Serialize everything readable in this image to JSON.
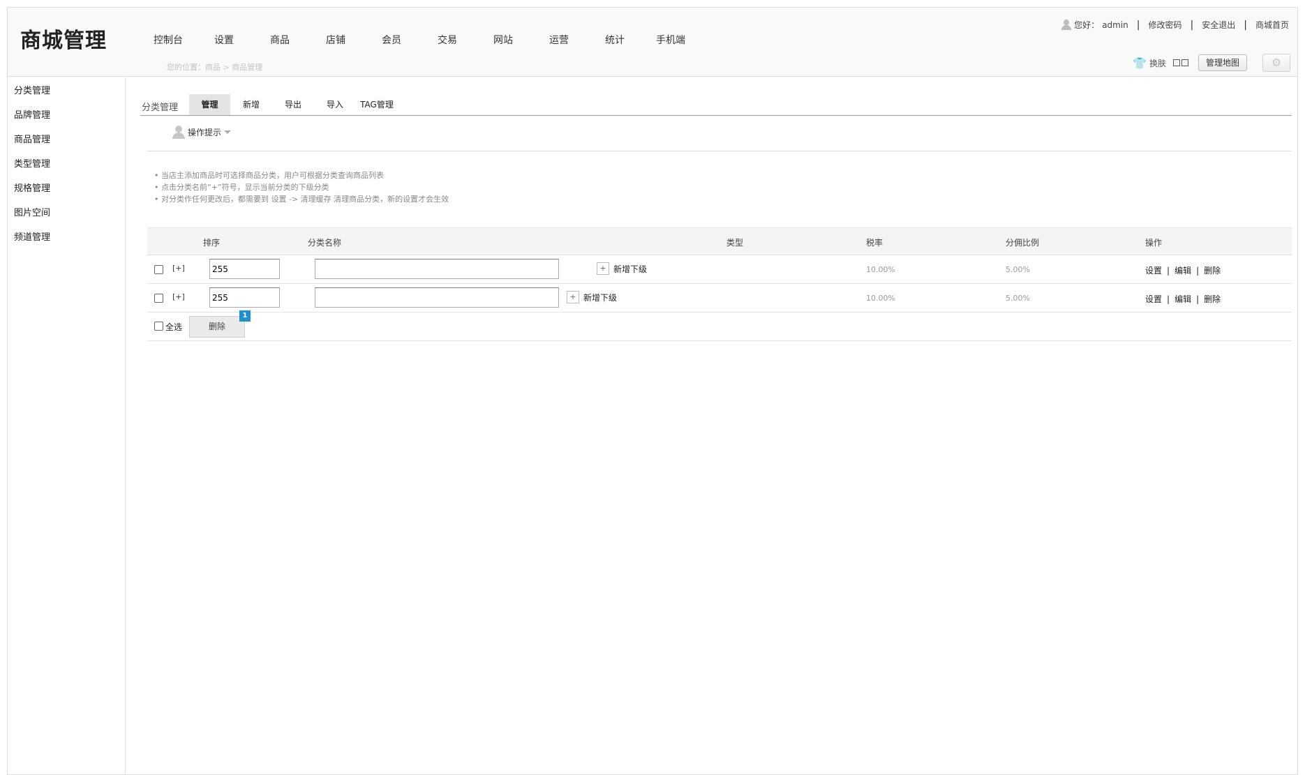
{
  "header": {
    "logo": "商城管理",
    "nav": [
      "控制台",
      "设置",
      "商品",
      "店铺",
      "会员",
      "交易",
      "网站",
      "运营",
      "统计",
      "手机端"
    ],
    "breadcrumb": "您的位置：商品 > 商品管理",
    "greeting": "您好：",
    "username": "admin",
    "change_password": "修改密码",
    "logout": "安全退出",
    "store_home": "商城首页",
    "skin_label": "换肤",
    "map_button": "管理地图"
  },
  "sidebar": {
    "items": [
      "分类管理",
      "品牌管理",
      "商品管理",
      "类型管理",
      "规格管理",
      "图片空间",
      "频道管理"
    ]
  },
  "tabs": {
    "title": "分类管理",
    "items": [
      "管理",
      "新增",
      "导出",
      "导入",
      "TAG管理"
    ],
    "active": "管理"
  },
  "tips": {
    "toggle_label": "操作提示",
    "items": [
      "当店主添加商品时可选择商品分类，用户可根据分类查询商品列表",
      "点击分类名前“+”符号，显示当前分类的下级分类",
      "对分类作任何更改后，都需要到 设置 -> 清理缓存 清理商品分类，新的设置才会生效"
    ]
  },
  "table": {
    "columns": [
      "排序",
      "分类名称",
      "类型",
      "税率",
      "分佣比例",
      "操作"
    ],
    "rows": [
      {
        "expand": "[+]",
        "sort": "255",
        "name": "",
        "add_sub": "新增下级",
        "tax": "10.00%",
        "commission": "5.00%",
        "ops": [
          "设置",
          "编辑",
          "删除"
        ]
      },
      {
        "expand": "[+]",
        "sort": "255",
        "name": "",
        "add_sub": "新增下级",
        "tax": "10.00%",
        "commission": "5.00%",
        "ops": [
          "设置",
          "编辑",
          "删除"
        ]
      }
    ],
    "footer": {
      "select_all": "全选",
      "delete_button": "删除",
      "badge": "1"
    }
  }
}
